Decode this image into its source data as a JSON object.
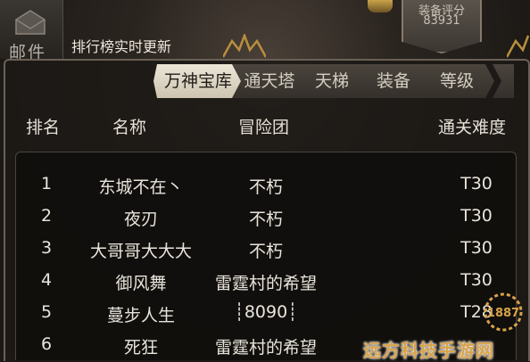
{
  "mail": {
    "label": "邮件"
  },
  "rank_title": "排行榜实时更新",
  "score": {
    "label": "装备评分",
    "value": "83931"
  },
  "tabs": [
    "万神宝库",
    "通天塔",
    "天梯",
    "装备",
    "等级"
  ],
  "active_tab": 0,
  "columns": {
    "rank": "排名",
    "name": "名称",
    "team": "冒险团",
    "difficulty": "通关难度"
  },
  "rows": [
    {
      "rank": "1",
      "name": "东城不在丶",
      "team": "不朽",
      "difficulty": "T30"
    },
    {
      "rank": "2",
      "name": "夜刃",
      "team": "不朽",
      "difficulty": "T30"
    },
    {
      "rank": "3",
      "name": "大哥哥大大大",
      "team": "不朽",
      "difficulty": "T30"
    },
    {
      "rank": "4",
      "name": "御风舞",
      "team": "雷霆村的希望",
      "difficulty": "T30"
    },
    {
      "rank": "5",
      "name": "蔓步人生",
      "team": "┊8090┊",
      "difficulty": "T28"
    },
    {
      "rank": "6",
      "name": "死狂",
      "team": "雷霆村的希望",
      "difficulty": ""
    }
  ],
  "watermark": {
    "text": "远方科技手游网",
    "logo": "1887"
  },
  "colors": {
    "accent_gold": "#d9a34a",
    "active_tab": "#ece6d8",
    "panel_border": "#6a6157"
  }
}
